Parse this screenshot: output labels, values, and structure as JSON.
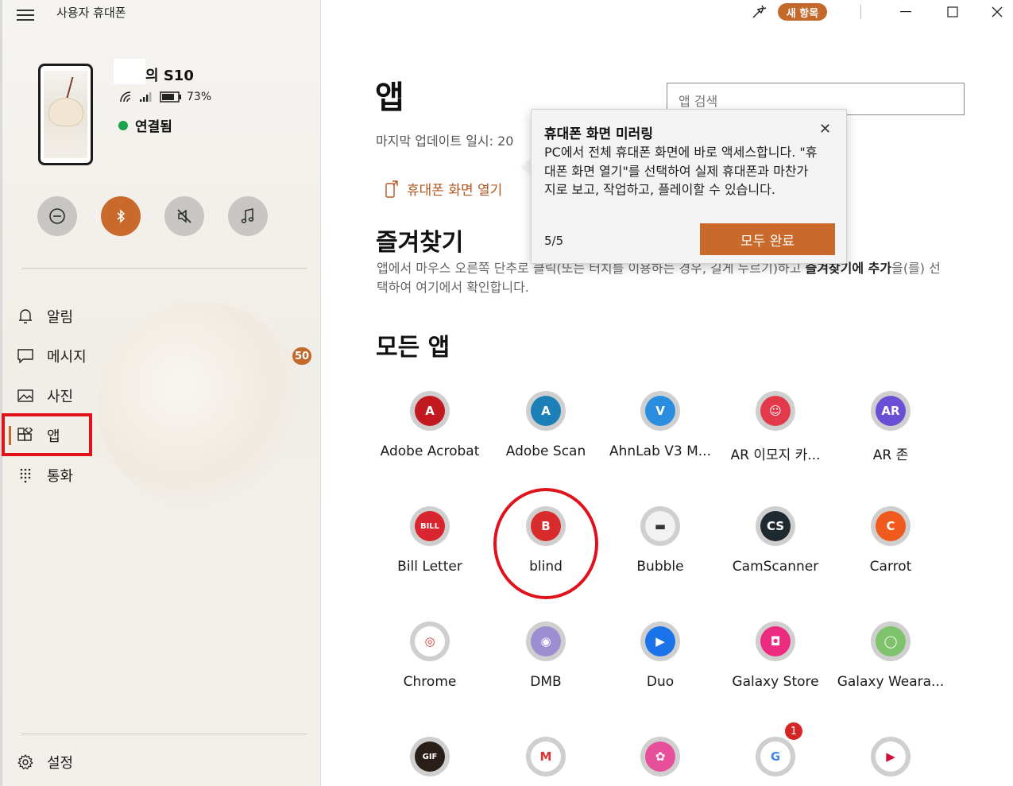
{
  "app_title": "사용자 휴대폰",
  "device": {
    "name": "의 S10",
    "battery": "73%",
    "status": "연결됨"
  },
  "nav": [
    {
      "label": "알림"
    },
    {
      "label": "메시지",
      "badge": "50"
    },
    {
      "label": "사진"
    },
    {
      "label": "앱"
    },
    {
      "label": "통화"
    }
  ],
  "settings_label": "설정",
  "header": {
    "new_items": "새 항목"
  },
  "main": {
    "title": "앱",
    "search_placeholder": "앱 검색",
    "last_update": "마지막 업데이트 일시: 20",
    "open_mirror": "휴대폰 화면 열기",
    "favorites_title": "즐겨찾기",
    "favorites_desc_1": "앱에서 마우스 오른쪽 단추로 클릭(또는 터치를 이용하는 경우, 길게 누르기)하고 ",
    "favorites_desc_bold_1": "즐겨찾기",
    "favorites_desc_bold_2": "에 추가",
    "favorites_desc_2": "을(를) 선택하여 여기에서 확인합니다.",
    "all_apps_title": "모든 앱"
  },
  "apps": [
    {
      "name": "Adobe Acrobat",
      "icon": "acrobat-icon",
      "color": "#c1191f"
    },
    {
      "name": "Adobe Scan",
      "icon": "adobe-scan-icon",
      "color": "#1d7fb8"
    },
    {
      "name": "AhnLab V3 M...",
      "icon": "ahnlab-icon",
      "color": "#2a8de0"
    },
    {
      "name": "AR 이모지 카...",
      "icon": "ar-emoji-icon",
      "color": "#e23a4b"
    },
    {
      "name": "AR 존",
      "icon": "ar-zone-icon",
      "color": "#6a4fd6"
    },
    {
      "name": "Bill Letter",
      "icon": "bill-letter-icon",
      "color": "#d8252f"
    },
    {
      "name": "blind",
      "icon": "blind-icon",
      "color": "#d92b2b"
    },
    {
      "name": "Bubble",
      "icon": "bubble-icon",
      "color": "#f2f2f2"
    },
    {
      "name": "CamScanner",
      "icon": "camscanner-icon",
      "color": "#1f2a30"
    },
    {
      "name": "Carrot",
      "icon": "carrot-icon",
      "color": "#f05a1c"
    },
    {
      "name": "Chrome",
      "icon": "chrome-icon",
      "color": "#ffffff"
    },
    {
      "name": "DMB",
      "icon": "dmb-icon",
      "color": "#9c8ed0"
    },
    {
      "name": "Duo",
      "icon": "duo-icon",
      "color": "#1a73e8"
    },
    {
      "name": "Galaxy Store",
      "icon": "galaxy-store-icon",
      "color": "#ec2a7f"
    },
    {
      "name": "Galaxy Weara...",
      "icon": "galaxy-wearable-icon",
      "color": "#7ec26b"
    },
    {
      "name": "",
      "icon": "gif-icon",
      "color": "#2a1f18"
    },
    {
      "name": "",
      "icon": "gmail-icon",
      "color": "#ffffff"
    },
    {
      "name": "",
      "icon": "gallery-icon",
      "color": "#e84f9b"
    },
    {
      "name": "",
      "icon": "google-icon",
      "color": "#ffffff",
      "notif": "1"
    },
    {
      "name": "",
      "icon": "play-movies-icon",
      "color": "#ffffff"
    }
  ],
  "tooltip": {
    "title": "휴대폰 화면 미러링",
    "body": "PC에서 전체 휴대폰 화면에 바로 액세스합니다. \"휴대폰 화면 열기\"를 선택하여 실제 휴대폰과 마찬가지로 보고, 작업하고, 플레이할 수 있습니다.",
    "count": "5/5",
    "button": "모두 완료"
  },
  "colors": {
    "accent": "#c96a2c",
    "annotation": "#e0131c",
    "connected": "#1aa34a"
  }
}
